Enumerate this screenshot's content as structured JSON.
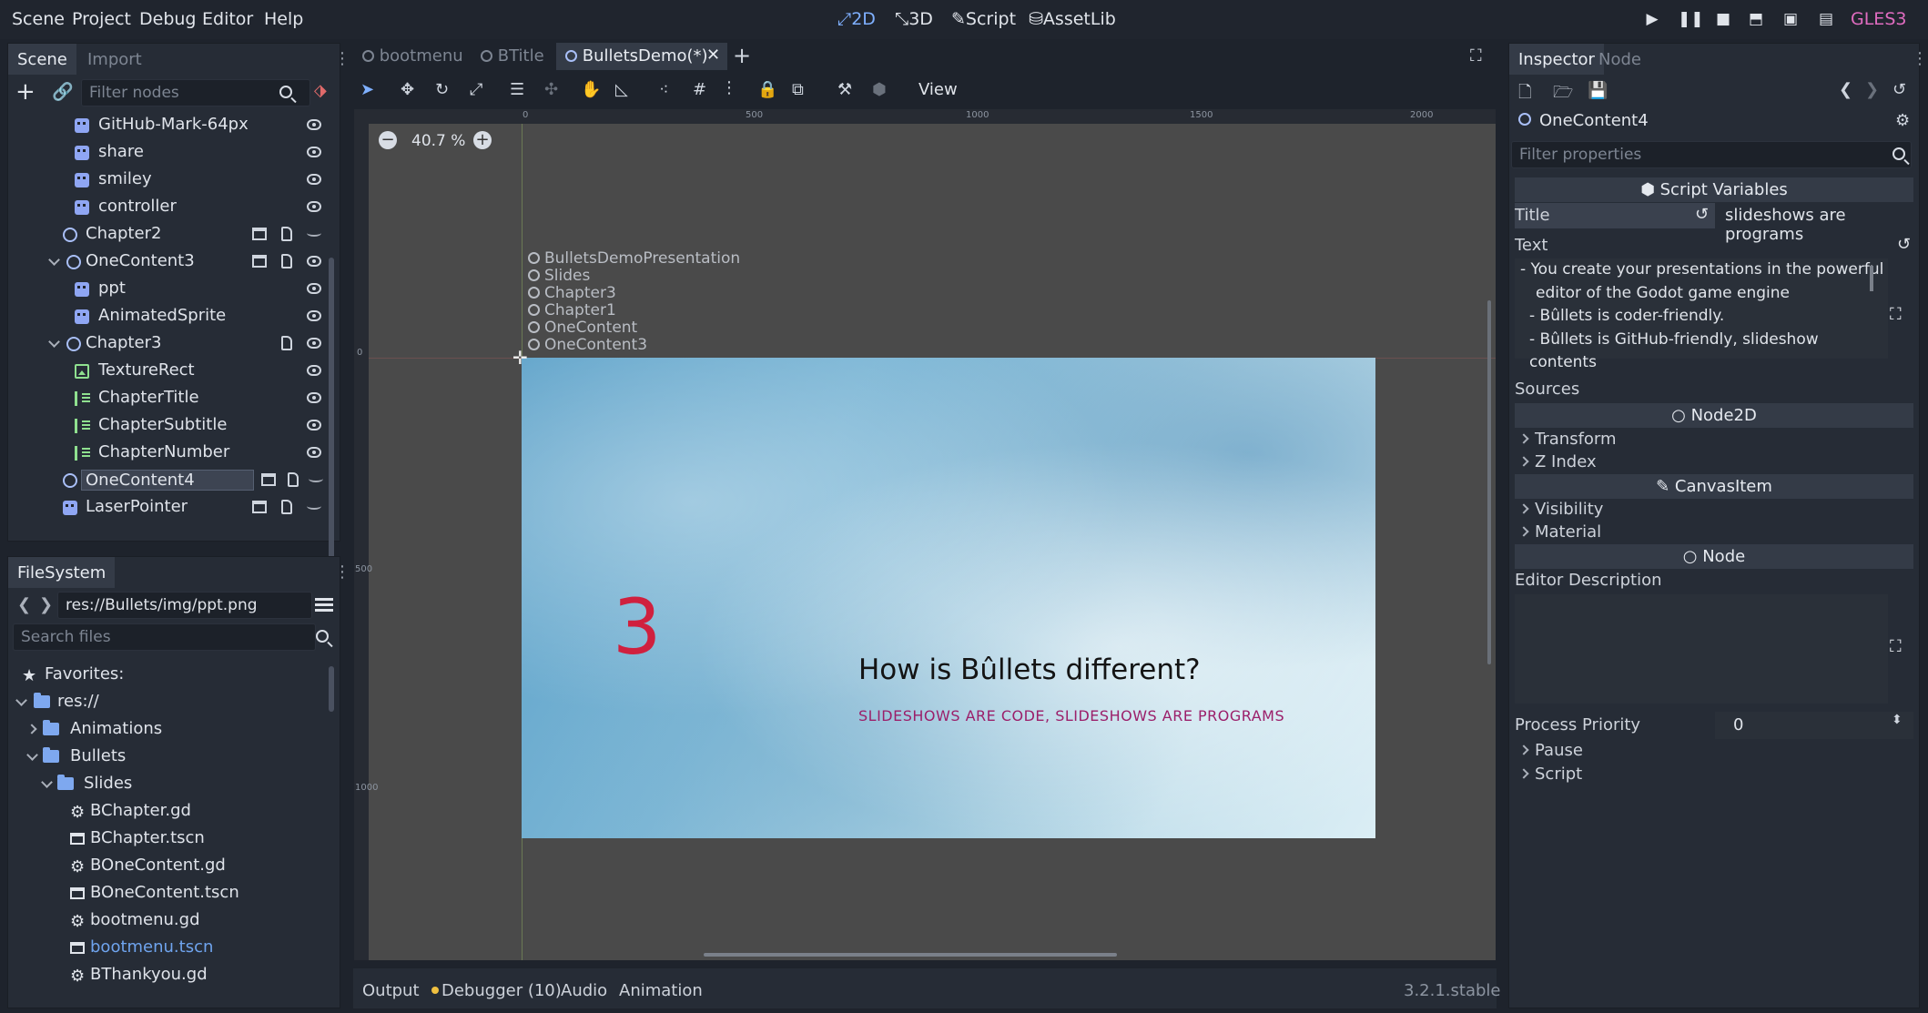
{
  "menu": [
    "Scene",
    "Project",
    "Debug",
    "Editor",
    "Help"
  ],
  "modes": [
    {
      "label": "2D",
      "active": true
    },
    {
      "label": "3D",
      "active": false
    },
    {
      "label": "Script",
      "active": false
    },
    {
      "label": "AssetLib",
      "active": false
    }
  ],
  "renderer": "GLES3",
  "scene_dock": {
    "tabs": [
      "Scene",
      "Import"
    ],
    "filter_placeholder": "Filter nodes",
    "nodes": [
      {
        "name": "GitHub-Mark-64px",
        "icon": "sprite-icon"
      },
      {
        "name": "share",
        "icon": "sprite-icon"
      },
      {
        "name": "smiley",
        "icon": "sprite-icon"
      },
      {
        "name": "controller",
        "icon": "sprite-icon"
      },
      {
        "name": "Chapter2",
        "icon": "node2d-icon"
      },
      {
        "name": "OneContent3",
        "icon": "node2d-icon"
      },
      {
        "name": "ppt",
        "icon": "sprite-icon"
      },
      {
        "name": "AnimatedSprite",
        "icon": "animated-sprite-icon"
      },
      {
        "name": "Chapter3",
        "icon": "node2d-icon"
      },
      {
        "name": "TextureRect",
        "icon": "texture-rect-icon"
      },
      {
        "name": "ChapterTitle",
        "icon": "label-icon"
      },
      {
        "name": "ChapterSubtitle",
        "icon": "label-icon"
      },
      {
        "name": "ChapterNumber",
        "icon": "label-icon"
      },
      {
        "name": "OneContent4",
        "icon": "node2d-icon",
        "selected": true
      },
      {
        "name": "LaserPointer",
        "icon": "sprite-icon"
      }
    ]
  },
  "filesystem": {
    "title": "FileSystem",
    "path": "res://Bullets/img/ppt.png",
    "search_placeholder": "Search files",
    "items": [
      {
        "label": "Favorites:",
        "kind": "favorites"
      },
      {
        "label": "res://",
        "kind": "folder"
      },
      {
        "label": "Animations",
        "kind": "folder"
      },
      {
        "label": "Bullets",
        "kind": "folder"
      },
      {
        "label": "Slides",
        "kind": "folder"
      },
      {
        "label": "BChapter.gd",
        "kind": "script"
      },
      {
        "label": "BChapter.tscn",
        "kind": "scene"
      },
      {
        "label": "BOneContent.gd",
        "kind": "script"
      },
      {
        "label": "BOneContent.tscn",
        "kind": "scene"
      },
      {
        "label": "bootmenu.gd",
        "kind": "script"
      },
      {
        "label": "bootmenu.tscn",
        "kind": "scene",
        "highlight": true
      },
      {
        "label": "BThankyou.gd",
        "kind": "script"
      }
    ]
  },
  "editor_tabs": [
    {
      "label": "bootmenu",
      "active": false
    },
    {
      "label": "BTitle",
      "active": false
    },
    {
      "label": "BulletsDemo(*)",
      "active": true
    }
  ],
  "toolbar": {
    "view_label": "View"
  },
  "viewport": {
    "zoom": "40.7 %",
    "ruler_top": [
      "0",
      "500",
      "1000",
      "1500",
      "2000"
    ],
    "ruler_left": [
      "0",
      "500",
      "1000"
    ],
    "overlay_nodes": [
      "BulletsDemoPresentation",
      "Slides",
      "Chapter3",
      "Chapter1",
      "OneContent",
      "OneContent3"
    ],
    "slide": {
      "number": "3",
      "title": "How is Bûllets different?",
      "subtitle": "SLIDESHOWS ARE CODE, SLIDESHOWS ARE PROGRAMS"
    }
  },
  "bottom_tabs": [
    "Output",
    "Debugger (10)",
    "Audio",
    "Animation"
  ],
  "version": "3.2.1.stable",
  "inspector": {
    "tabs": [
      "Inspector",
      "Node"
    ],
    "node_name": "OneContent4",
    "filter_placeholder": "Filter properties",
    "script_variables_header": "Script Variables",
    "title_label": "Title",
    "title_value": "slideshows are programs",
    "text_label": "Text",
    "text_lines": [
      "- You create your presentations in the powerful",
      "editor of the Godot game engine",
      "- Bûllets is coder-friendly.",
      "- Bûllets is GitHub-friendly, slideshow contents"
    ],
    "sources_label": "Sources",
    "node2d_header": "Node2D",
    "node2d_props": [
      "Transform",
      "Z Index"
    ],
    "canvasitem_header": "CanvasItem",
    "canvasitem_props": [
      "Visibility",
      "Material"
    ],
    "node_header": "Node",
    "editor_description_label": "Editor Description",
    "process_priority_label": "Process Priority",
    "process_priority_value": "0",
    "node_props": [
      "Pause",
      "Script"
    ]
  }
}
